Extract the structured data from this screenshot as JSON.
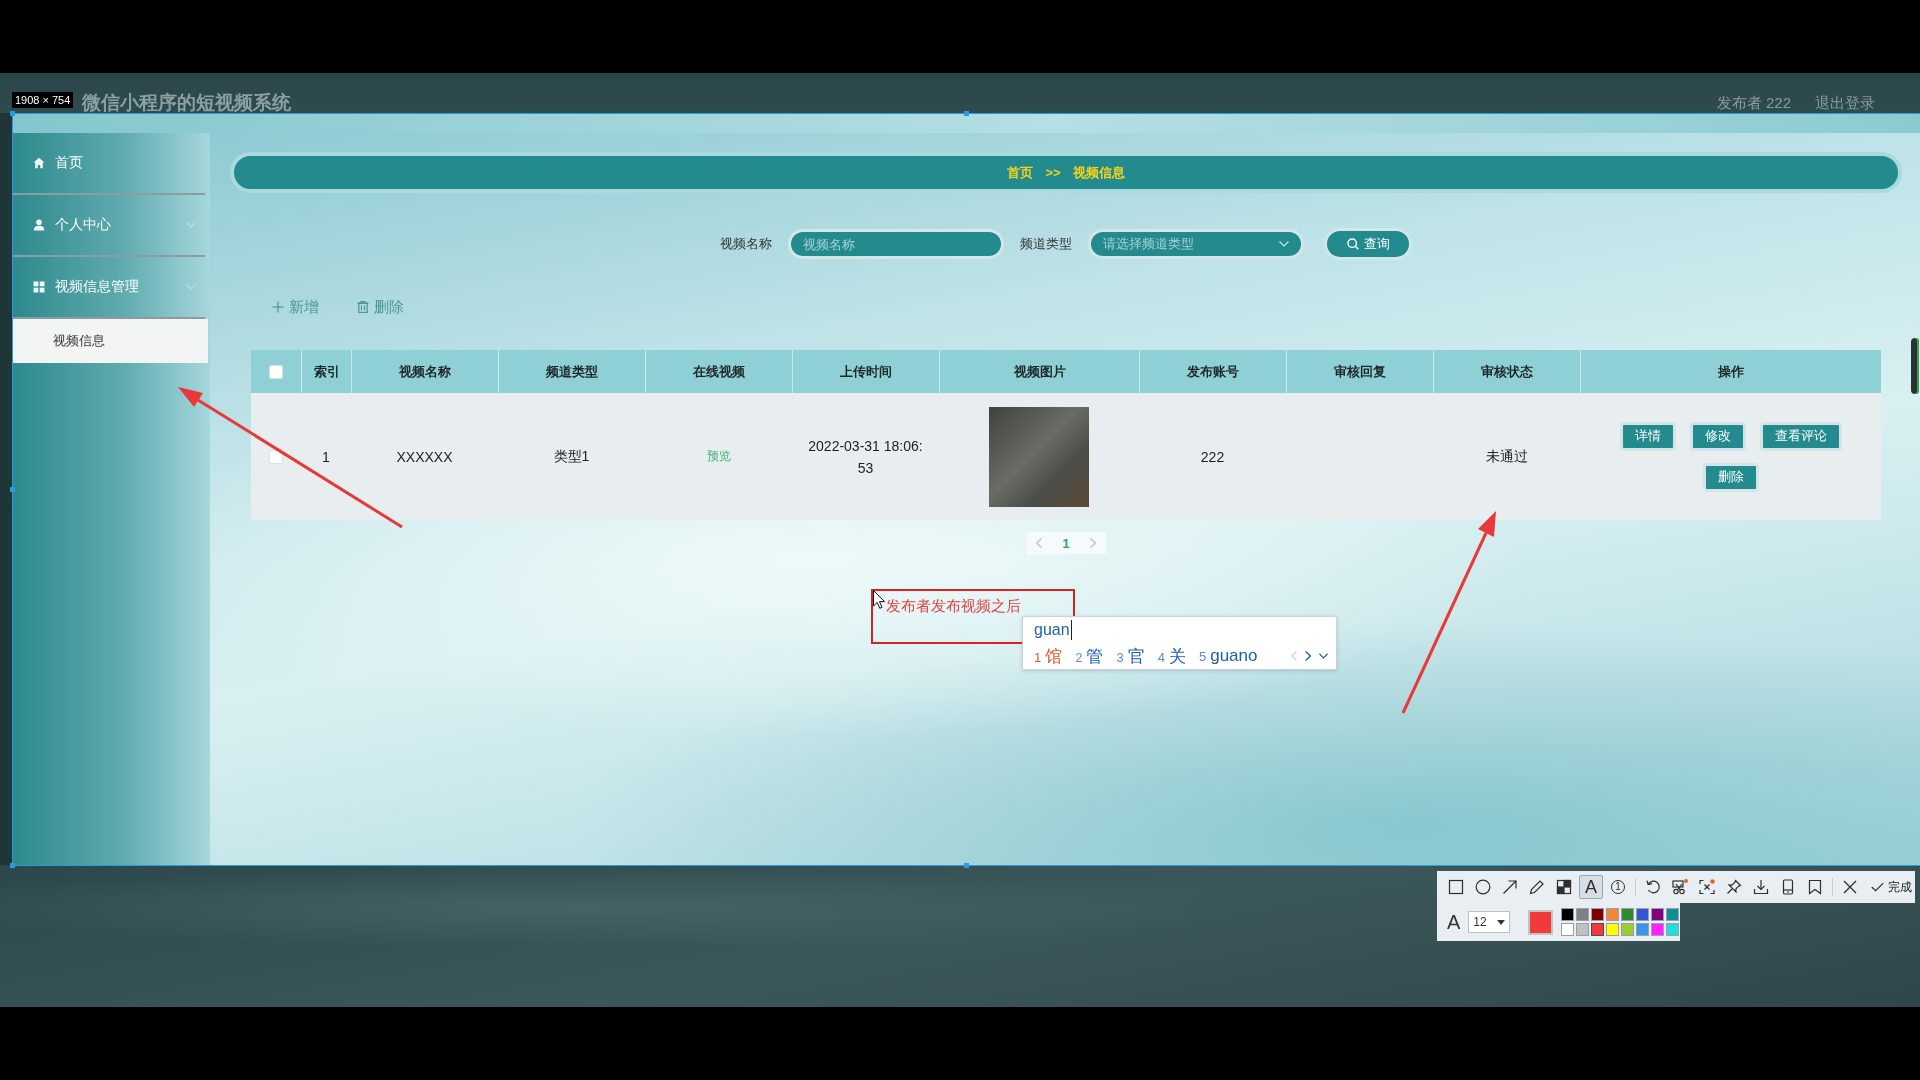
{
  "header": {
    "title": "微信小程序的短视频系统",
    "user": "发布者 222",
    "logout": "退出登录"
  },
  "capture": {
    "size_label": "1908 × 754",
    "toolbar": {
      "drawing_tools": [
        {
          "kind": "icon",
          "selected": false
        },
        {
          "kind": "icon",
          "selected": false
        },
        {
          "kind": "icon",
          "selected": false
        },
        {
          "kind": "icon",
          "selected": false
        },
        {
          "kind": "icon",
          "selected": false
        },
        {
          "kind": "glyph",
          "glyph": "A",
          "selected": true
        },
        {
          "kind": "numbered",
          "glyph": "1",
          "selected": false
        }
      ],
      "actions": [
        {
          "badge": false
        },
        {
          "badge": true
        },
        {
          "badge": true
        },
        {
          "badge": false
        },
        {
          "badge": false
        },
        {
          "badge": false
        },
        {
          "badge": false
        }
      ],
      "done_label": "完成"
    },
    "style_bar": {
      "font_glyph": "A",
      "font_size": "12",
      "palette": [
        {
          "color": "#000000",
          "selected": false
        },
        {
          "color": "#808080",
          "selected": false
        },
        {
          "color": "#800000",
          "selected": false
        },
        {
          "color": "#f0883a",
          "selected": false
        },
        {
          "color": "#2e8b2e",
          "selected": false
        },
        {
          "color": "#3556d6",
          "selected": false
        },
        {
          "color": "#800080",
          "selected": false
        },
        {
          "color": "#0a9090",
          "selected": false
        },
        {
          "color": "#ffffff",
          "selected": false
        },
        {
          "color": "#c0c0c0",
          "selected": false
        },
        {
          "color": "#f23a3a",
          "selected": true
        },
        {
          "color": "#ffff00",
          "selected": false
        },
        {
          "color": "#9acd32",
          "selected": false
        },
        {
          "color": "#3a96e6",
          "selected": false
        },
        {
          "color": "#ff22ff",
          "selected": false
        },
        {
          "color": "#22dddd",
          "selected": false
        }
      ]
    }
  },
  "sidebar": {
    "items": [
      {
        "label": "首页",
        "kind": "link",
        "selected": false
      },
      {
        "label": "个人中心",
        "kind": "submenu",
        "selected": false
      },
      {
        "label": "视频信息管理",
        "kind": "submenu",
        "selected": false,
        "children": [
          {
            "label": "视频信息",
            "selected": true
          }
        ]
      }
    ]
  },
  "breadcrumb": {
    "items": [
      "首页",
      "视频信息"
    ],
    "separator": ">>"
  },
  "search": {
    "fields": [
      {
        "label": "视频名称",
        "kind": "input",
        "placeholder": "视频名称"
      },
      {
        "label": "频道类型",
        "kind": "select",
        "placeholder": "请选择频道类型"
      }
    ],
    "button": "查询"
  },
  "actions": [
    {
      "label": "新增"
    },
    {
      "label": "删除"
    }
  ],
  "table": {
    "select_all": {
      "checked": false
    },
    "columns": [
      "索引",
      "视频名称",
      "频道类型",
      "在线视频",
      "上传时间",
      "视频图片",
      "发布账号",
      "审核回复",
      "审核状态",
      "操作"
    ],
    "rows": [
      {
        "checked": false,
        "index": "1",
        "name": "XXXXXX",
        "channel": "类型1",
        "online_video": "预览",
        "upload_time": "2022-03-31 18:06:53",
        "publisher": "222",
        "review_status": "未通过",
        "buttons": [
          "详情",
          "修改",
          "查看评论",
          "删除"
        ]
      }
    ]
  },
  "pagination": {
    "pages": [
      {
        "label": "1",
        "selected": true
      }
    ]
  },
  "annotation": {
    "text": "发布者发布视频之后"
  },
  "ime": {
    "composition": "guan",
    "candidates": [
      {
        "number": "1",
        "text": "馆",
        "selected": true
      },
      {
        "number": "2",
        "text": "管",
        "selected": false
      },
      {
        "number": "3",
        "text": "官",
        "selected": false
      },
      {
        "number": "4",
        "text": "关",
        "selected": false
      },
      {
        "number": "5",
        "text": "guano",
        "selected": false
      }
    ]
  }
}
